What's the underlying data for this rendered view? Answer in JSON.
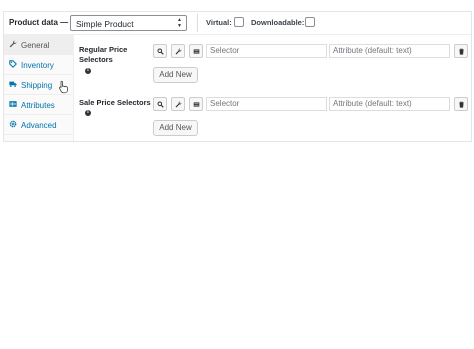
{
  "header": {
    "title": "Product data —",
    "product_type": "Simple Product",
    "virtual_label": "Virtual:",
    "downloadable_label": "Downloadable:"
  },
  "sidebar": {
    "tabs": [
      {
        "label": "General",
        "icon": "wrench-icon",
        "active": true
      },
      {
        "label": "Inventory",
        "icon": "tag-icon",
        "active": false
      },
      {
        "label": "Shipping",
        "icon": "truck-icon",
        "active": false
      },
      {
        "label": "Attributes",
        "icon": "table-icon",
        "active": false
      },
      {
        "label": "Advanced",
        "icon": "gear-icon",
        "active": false
      }
    ]
  },
  "fields": [
    {
      "label": "Regular Price Selectors",
      "selector_placeholder": "Selector",
      "attribute_placeholder": "Attribute (default: text)",
      "add_new_label": "Add New"
    },
    {
      "label": "Sale Price Selectors",
      "selector_placeholder": "Selector",
      "attribute_placeholder": "Attribute (default: text)",
      "add_new_label": "Add New"
    }
  ],
  "colors": {
    "link": "#0073aa",
    "border": "#dddddd",
    "active_tab": "#eeeeee"
  }
}
